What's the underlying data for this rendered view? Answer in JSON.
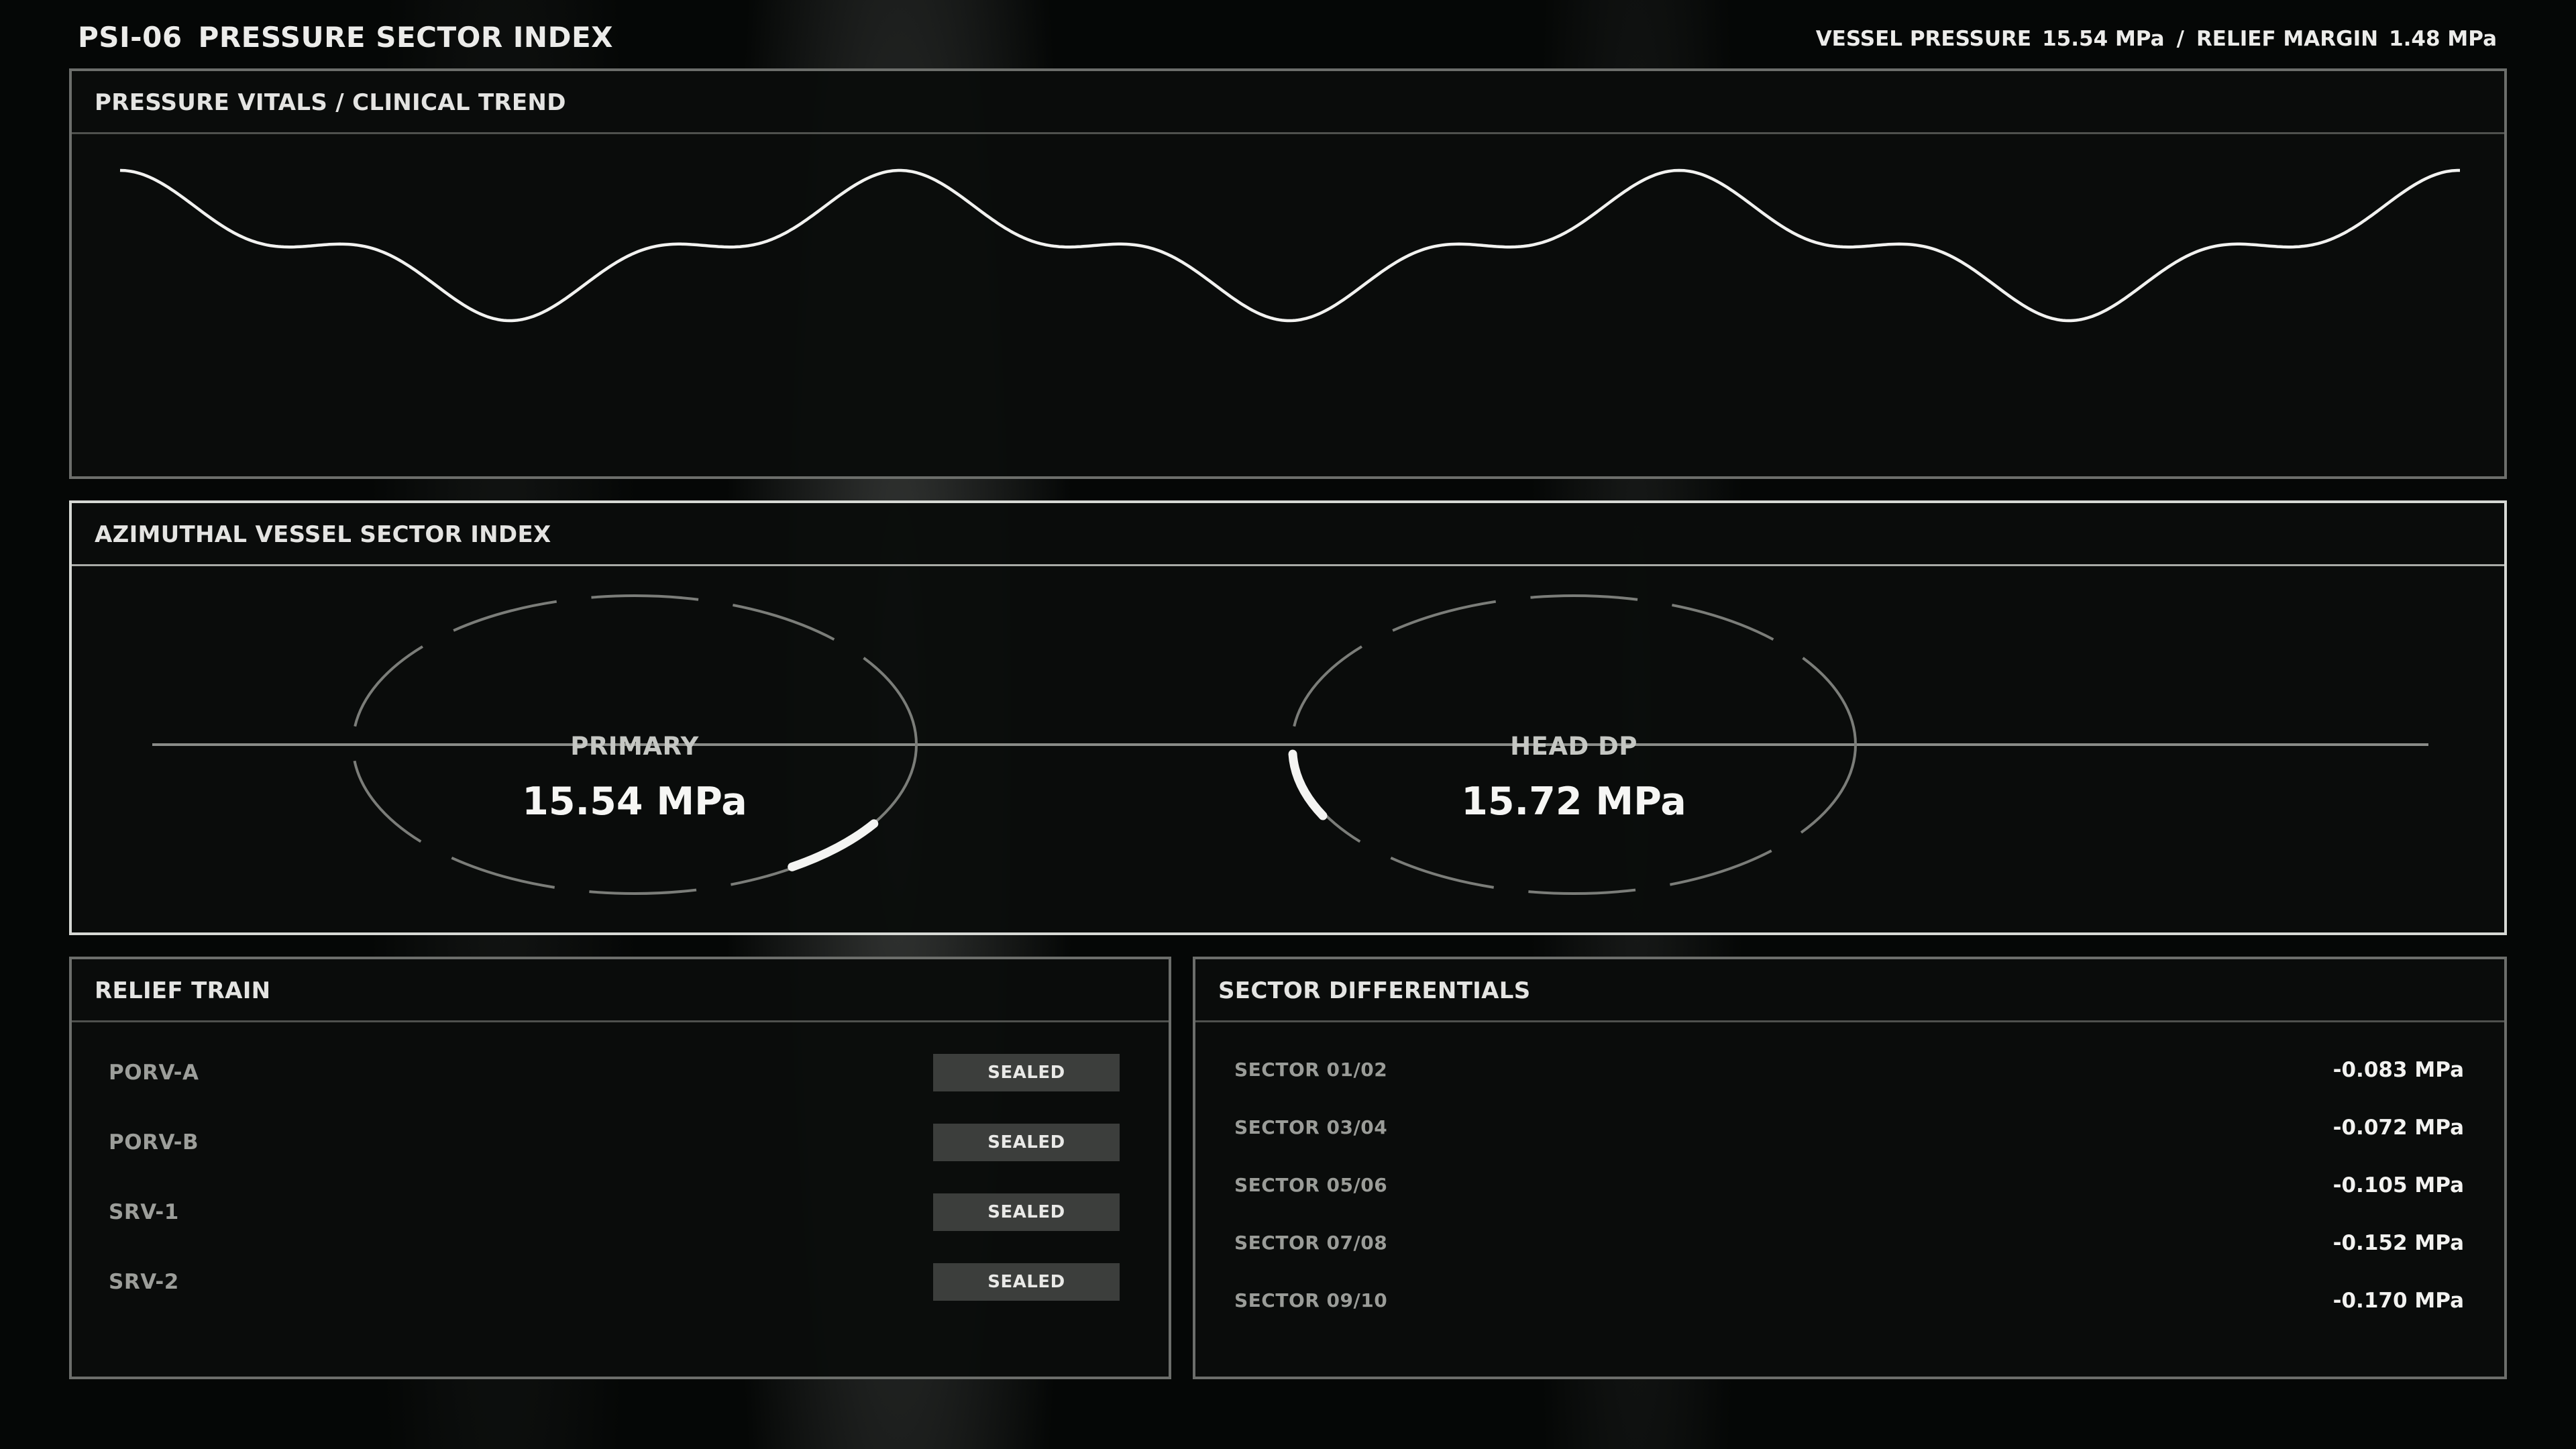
{
  "header": {
    "code": "PSI-06",
    "title": "PRESSURE SECTOR INDEX",
    "vessel_pressure_label": "VESSEL PRESSURE",
    "vessel_pressure_value": "15.54 MPa",
    "separator": "/",
    "relief_margin_label": "RELIEF MARGIN",
    "relief_margin_value": "1.48 MPa"
  },
  "trend": {
    "title": "PRESSURE VITALS / CLINICAL TREND",
    "color": "#f2f2f0"
  },
  "sector_index": {
    "title": "AZIMUTHAL VESSEL SECTOR INDEX",
    "dials": [
      {
        "label": "PRIMARY",
        "value": "15.54 MPa"
      },
      {
        "label": "HEAD DP",
        "value": "15.72 MPa"
      }
    ]
  },
  "relief_train": {
    "title": "RELIEF TRAIN",
    "items": [
      {
        "name": "PORV-A",
        "status": "SEALED"
      },
      {
        "name": "PORV-B",
        "status": "SEALED"
      },
      {
        "name": "SRV-1",
        "status": "SEALED"
      },
      {
        "name": "SRV-2",
        "status": "SEALED"
      }
    ]
  },
  "sector_differentials": {
    "title": "SECTOR DIFFERENTIALS",
    "rows": [
      {
        "sector": "SECTOR 01/02",
        "value": "-0.083 MPa"
      },
      {
        "sector": "SECTOR 03/04",
        "value": "-0.072 MPa"
      },
      {
        "sector": "SECTOR 05/06",
        "value": "-0.105 MPa"
      },
      {
        "sector": "SECTOR 07/08",
        "value": "-0.152 MPa"
      },
      {
        "sector": "SECTOR 09/10",
        "value": "-0.170 MPa"
      }
    ]
  }
}
